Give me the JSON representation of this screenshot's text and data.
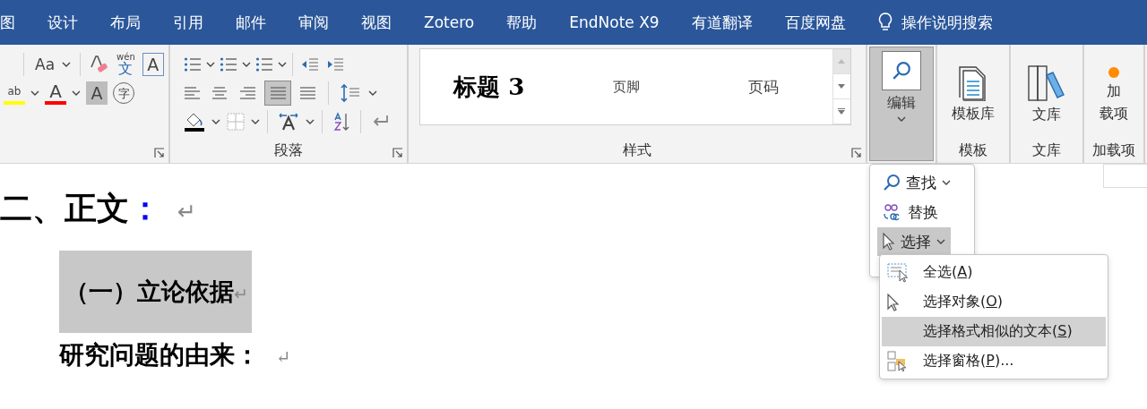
{
  "menu_tabs": [
    {
      "label": "图"
    },
    {
      "label": "设计"
    },
    {
      "label": "布局"
    },
    {
      "label": "引用"
    },
    {
      "label": "邮件"
    },
    {
      "label": "审阅"
    },
    {
      "label": "视图"
    },
    {
      "label": "Zotero"
    },
    {
      "label": "帮助"
    },
    {
      "label": "EndNote X9"
    },
    {
      "label": "有道翻译"
    },
    {
      "label": "百度网盘"
    }
  ],
  "tell_me": {
    "label": "操作说明搜索"
  },
  "font_group": {
    "case_glyph": "Aa",
    "pinyin_top": "wén",
    "pinyin_char": "文",
    "border_glyph": "A",
    "highlight_glyph": "ab",
    "color_glyph": "A",
    "shade_glyph": "A",
    "enclose_glyph": "字"
  },
  "paragraph_group": {
    "label": "段落",
    "align_buttons": [
      {
        "selected": false
      },
      {
        "selected": false
      },
      {
        "selected": false
      },
      {
        "selected": true
      },
      {
        "selected": false
      }
    ]
  },
  "styles_group": {
    "label": "样式",
    "styles": [
      {
        "label": "标题 3",
        "kind": "heading"
      },
      {
        "label": "页脚",
        "kind": "small"
      },
      {
        "label": "页码",
        "kind": "normal"
      }
    ]
  },
  "edit_group": {
    "label": "编辑",
    "expanded": true
  },
  "big_groups": [
    {
      "button": [
        "模板库"
      ],
      "label": "模板",
      "kind": "template"
    },
    {
      "button": [
        "文库"
      ],
      "label": "文库",
      "kind": "library"
    },
    {
      "button": [
        "加",
        "载项"
      ],
      "label": "加载项",
      "kind": "addin"
    }
  ],
  "edit_menu": [
    {
      "label": "查找",
      "kind": "find",
      "has_submenu": true,
      "selected": false
    },
    {
      "label": "替换",
      "kind": "replace",
      "has_submenu": false,
      "selected": false
    },
    {
      "label": "选择",
      "kind": "select",
      "has_submenu": true,
      "selected": true
    }
  ],
  "select_menu": [
    {
      "before": "全选(",
      "key": "A",
      "after": ")",
      "kind": "all",
      "selected": false
    },
    {
      "before": "选择对象(",
      "key": "O",
      "after": ")",
      "kind": "object",
      "selected": false
    },
    {
      "before": "选择格式相似的文本(",
      "key": "S",
      "after": ")",
      "kind": "similar",
      "selected": true
    },
    {
      "before": "选择窗格(",
      "key": "P",
      "after": ")...",
      "kind": "pane",
      "selected": false
    }
  ],
  "document": [
    {
      "text": "二、正文",
      "tail": "：",
      "mark": "↵",
      "kind": "heading",
      "selected": false
    },
    {
      "text": "（一）立论依据",
      "mark": "↵",
      "kind": "subheading",
      "selected": true
    },
    {
      "text": "研究问题的由来：",
      "mark": "↵",
      "kind": "body",
      "selected": false
    }
  ]
}
